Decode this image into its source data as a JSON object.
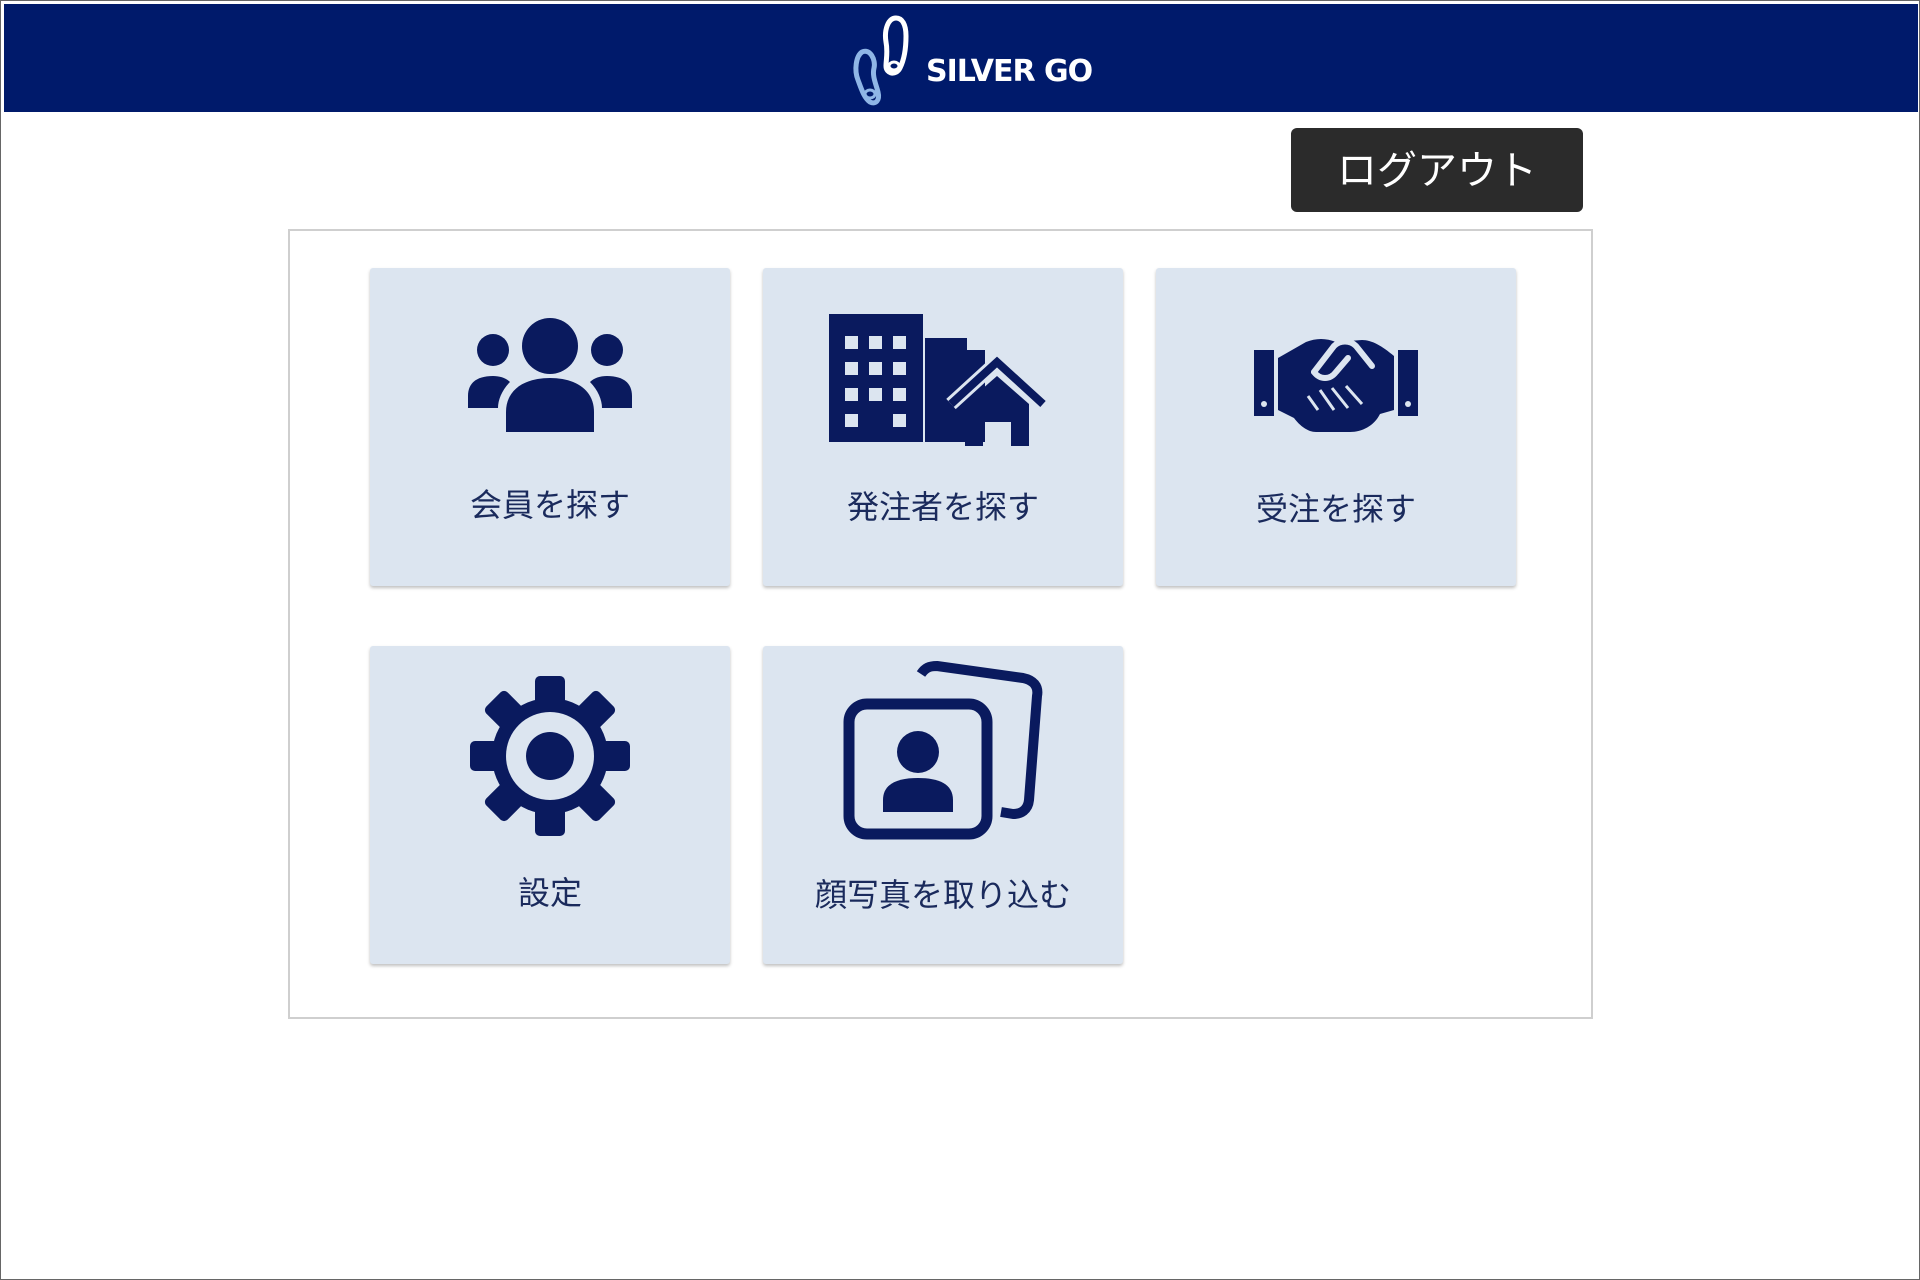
{
  "header": {
    "logo_text": "SILVER GO",
    "logout_label": "ログアウト"
  },
  "colors": {
    "header_bg": "#001a6b",
    "icon": "#0a1a5e",
    "tile_bg": "#dce5f0",
    "logout_bg": "#2b2b2b"
  },
  "menu": {
    "items": [
      {
        "label": "会員を探す",
        "icon": "users-icon"
      },
      {
        "label": "発注者を探す",
        "icon": "building-house-icon"
      },
      {
        "label": "受注を探す",
        "icon": "handshake-icon"
      },
      {
        "label": "設定",
        "icon": "gear-icon"
      },
      {
        "label": "顔写真を取り込む",
        "icon": "photo-import-icon"
      }
    ]
  }
}
